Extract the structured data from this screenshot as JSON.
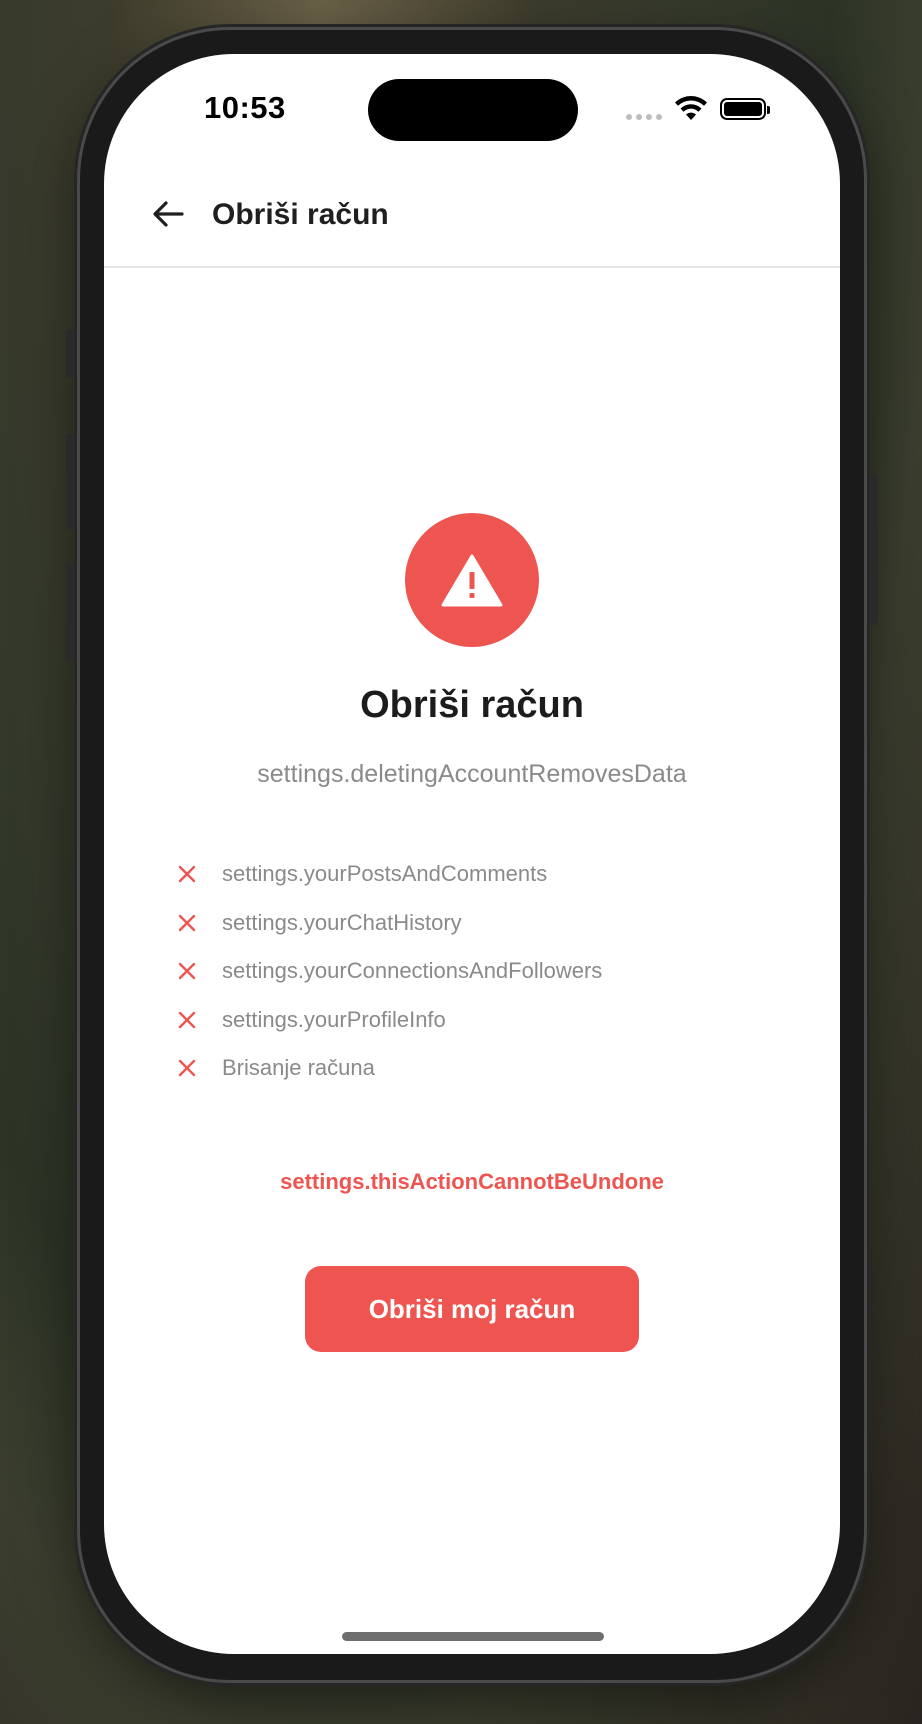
{
  "status_bar": {
    "time": "10:53"
  },
  "app_bar": {
    "title": "Obriši račun",
    "back_icon": "arrow-left-icon"
  },
  "content": {
    "warning_icon": "warning-triangle-icon",
    "heading": "Obriši račun",
    "subtitle": "settings.deletingAccountRemovesData",
    "items": [
      {
        "label": "settings.yourPostsAndComments"
      },
      {
        "label": "settings.yourChatHistory"
      },
      {
        "label": "settings.yourConnectionsAndFollowers"
      },
      {
        "label": "settings.yourProfileInfo"
      },
      {
        "label": "Brisanje računa"
      }
    ],
    "irreversible_notice": "settings.thisActionCannotBeUndone",
    "delete_button_label": "Obriši moj račun"
  },
  "colors": {
    "accent_red": "#ee5550",
    "text_dark": "#1c1c1c",
    "text_muted": "#8a8a8a"
  }
}
